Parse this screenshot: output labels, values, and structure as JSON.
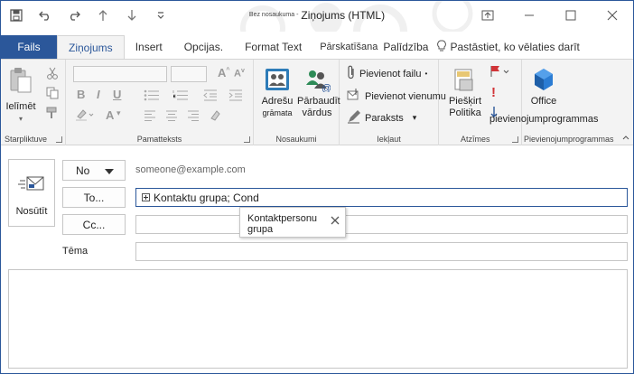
{
  "title": {
    "prefix": "Bez nosaukuma -",
    "main": "Ziņojums (HTML)"
  },
  "tabs": [
    "Fails",
    "Ziņojums",
    "Insert",
    "Opcijas.",
    "Format Text",
    "Pārskatīšana",
    "Palīdzība",
    "Pastāstiet, ko vēlaties darīt"
  ],
  "ribbon": {
    "clipboard": {
      "paste": "Ielīmēt",
      "label": "Starpliktuve"
    },
    "basic_text": {
      "label": "Pamatteksts"
    },
    "names": {
      "address_book_1": "Adrešu",
      "address_book_2": "grāmata",
      "check_names_1": "Pārbaudīt",
      "check_names_2": "vārdus",
      "label": "Nosaukumi"
    },
    "include": {
      "attach_file": "Pievienot failu",
      "attach_item": "Pievienot vienumu",
      "signature": "Paraksts",
      "label": "Iekļaut"
    },
    "tags": {
      "assign_policy_1": "Piešķirt",
      "assign_policy_2": "Politika",
      "label": "Atzīmes"
    },
    "addins": {
      "office": "Office",
      "get_addins": "pievienojumprogrammas",
      "label": "Pievienojumprogrammas"
    }
  },
  "compose": {
    "send_label": "Nosūtīt",
    "from_button": "No",
    "from_address": "someone@example.com",
    "to_button": "To...",
    "to_value": "Kontaktu grupa; Cond",
    "cc_button": "Cc...",
    "cc_value": "",
    "subject_label": "Tēma",
    "subject_value": "",
    "suggestion": "Kontaktpersonu grupa"
  },
  "colors": {
    "accent": "#2b579a",
    "ribbon_bg": "#f3f3f3",
    "flag_red": "#d13438"
  }
}
